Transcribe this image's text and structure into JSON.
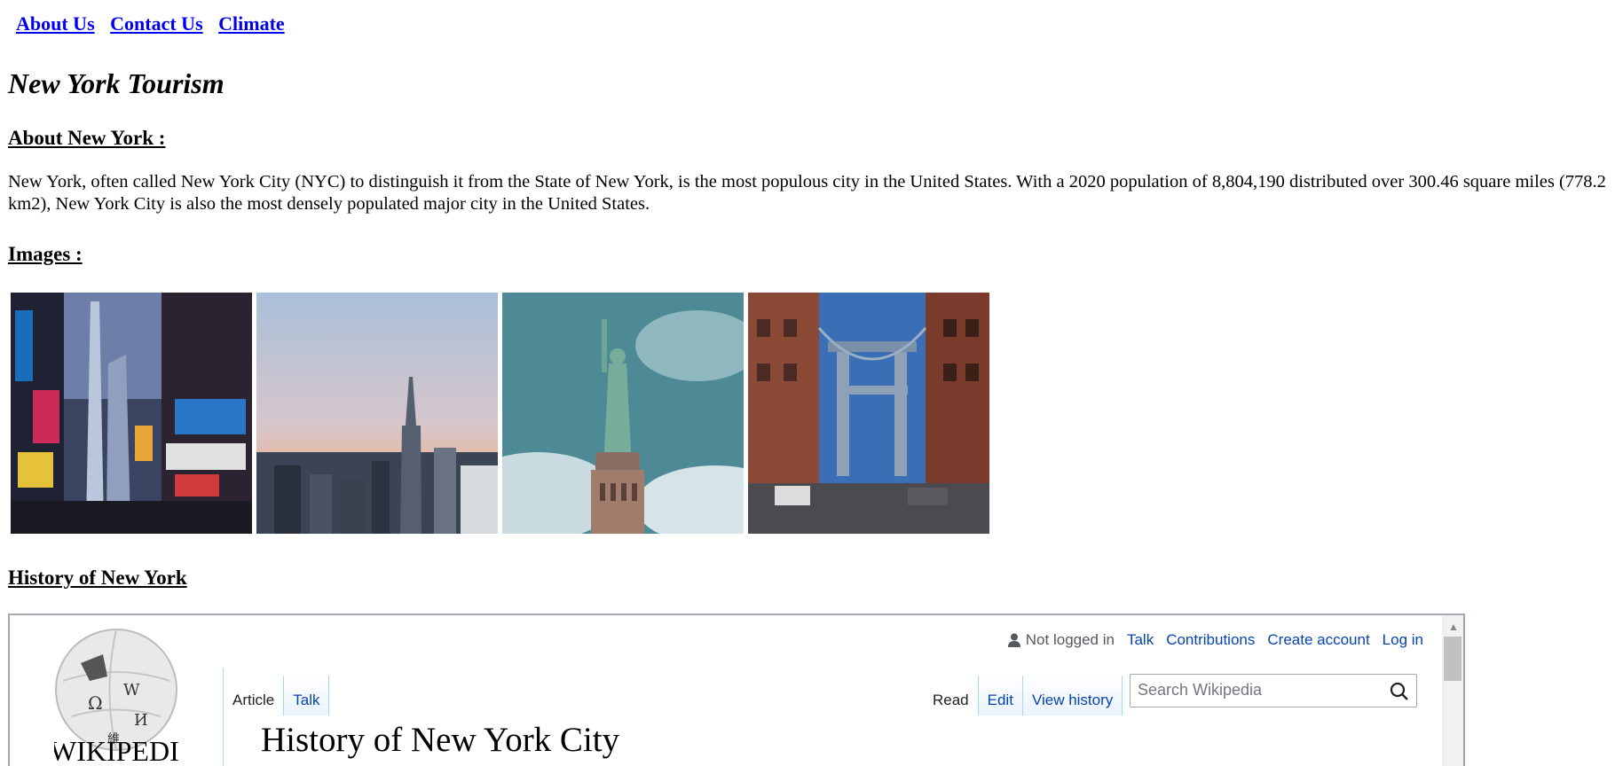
{
  "nav": {
    "links": [
      "About Us",
      "Contact Us",
      "Climate"
    ]
  },
  "page_title": "New York Tourism",
  "about": {
    "heading": "About New York :",
    "text": "New York, often called New York City (NYC) to distinguish it from the State of New York, is the most populous city in the United States. With a 2020 population of 8,804,190 distributed over 300.46 square miles (778.2 km2), New York City is also the most densely populated major city in the United States."
  },
  "images": {
    "heading": "Images :"
  },
  "history": {
    "heading": "History of New York"
  },
  "wiki": {
    "logo_text": "WIKIPEDIA",
    "personal": {
      "not_logged_in": "Not logged in",
      "talk": "Talk",
      "contributions": "Contributions",
      "create_account": "Create account",
      "log_in": "Log in"
    },
    "tabs_left": {
      "article": "Article",
      "talk": "Talk"
    },
    "tabs_right": {
      "read": "Read",
      "edit": "Edit",
      "view_history": "View history"
    },
    "search_placeholder": "Search Wikipedia",
    "article_title": "History of New York City"
  }
}
